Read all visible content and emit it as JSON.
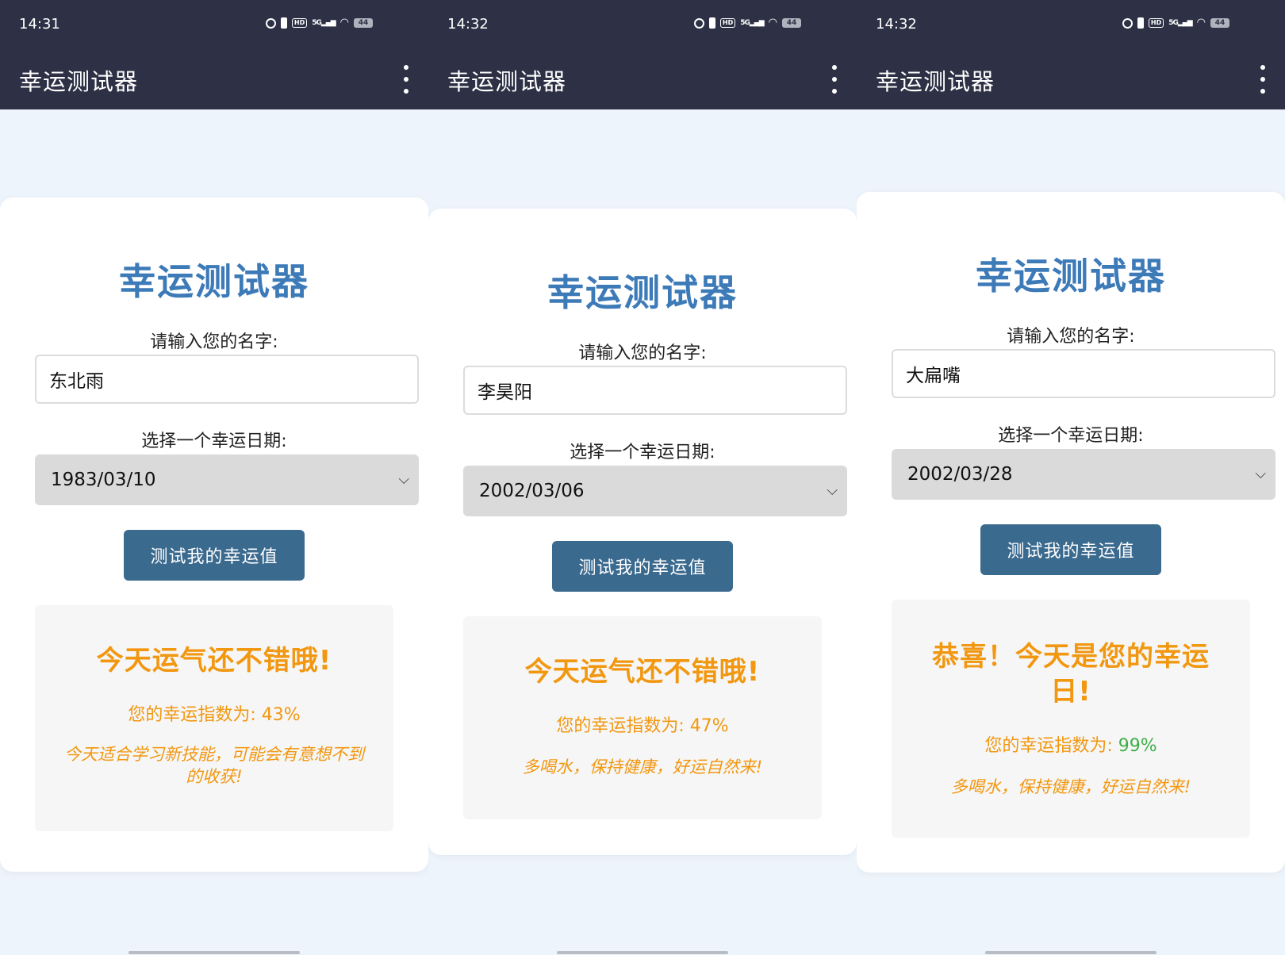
{
  "screens": [
    {
      "status": {
        "time": "14:31",
        "battery": "44"
      },
      "app_title": "幸运测试器",
      "card_title": "幸运测试器",
      "name_label": "请输入您的名字:",
      "name_value": "东北雨",
      "date_label": "选择一个幸运日期:",
      "date_value": "1983/03/10",
      "button_label": "测试我的幸运值",
      "result": {
        "headline": "今天运气还不错哦!",
        "score_prefix": "您的幸运指数为: ",
        "score_value": "43%",
        "advice": "今天适合学习新技能，可能会有意想不到的收获!"
      }
    },
    {
      "status": {
        "time": "14:32",
        "battery": "44"
      },
      "app_title": "幸运测试器",
      "card_title": "幸运测试器",
      "name_label": "请输入您的名字:",
      "name_value": "李昊阳",
      "date_label": "选择一个幸运日期:",
      "date_value": "2002/03/06",
      "button_label": "测试我的幸运值",
      "result": {
        "headline": "今天运气还不错哦!",
        "score_prefix": "您的幸运指数为: ",
        "score_value": "47%",
        "advice": "多喝水，保持健康，好运自然来!"
      }
    },
    {
      "status": {
        "time": "14:32",
        "battery": "44"
      },
      "app_title": "幸运测试器",
      "card_title": "幸运测试器",
      "name_label": "请输入您的名字:",
      "name_value": "大扁嘴",
      "date_label": "选择一个幸运日期:",
      "date_value": "2002/03/28",
      "button_label": "测试我的幸运值",
      "result": {
        "headline": "恭喜！今天是您的幸运日!",
        "score_prefix": "您的幸运指数为: ",
        "score_value": "99%",
        "advice": "多喝水，保持健康，好运自然来!"
      }
    }
  ],
  "colors": {
    "status_bar": "#2e3145",
    "title_blue": "#3d7ab8",
    "button_blue": "#3b6a8f",
    "result_orange": "#f29710",
    "score_green": "#3fae49",
    "background": "#eef4fb"
  }
}
